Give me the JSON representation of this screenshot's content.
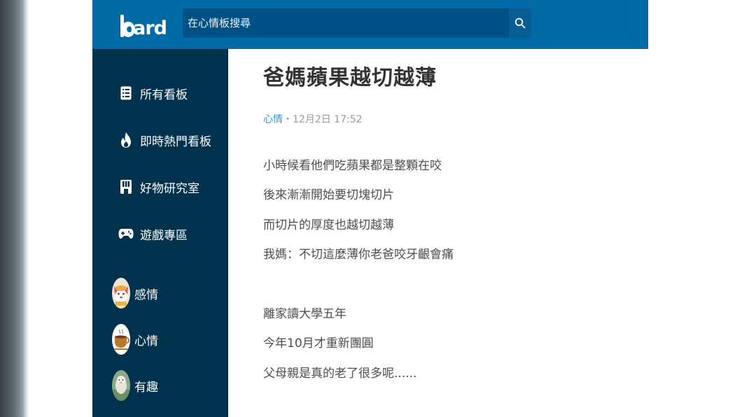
{
  "header": {
    "logo_text": "card",
    "search": {
      "placeholder": "在心情板搜尋"
    }
  },
  "sidebar": {
    "menu": [
      {
        "label": "所有看板",
        "icon": "list-icon"
      },
      {
        "label": "即時熱門看板",
        "icon": "flame-icon"
      },
      {
        "label": "好物研究室",
        "icon": "shop-icon"
      },
      {
        "label": "遊戲專區",
        "icon": "gamepad-icon"
      }
    ],
    "forums": [
      {
        "label": "感情",
        "icon": "dog-avatar"
      },
      {
        "label": "心情",
        "icon": "coffee-avatar"
      },
      {
        "label": "有趣",
        "icon": "alpaca-avatar"
      }
    ]
  },
  "post": {
    "title": "爸媽蘋果越切越薄",
    "forum": "心情",
    "separator": "・",
    "timestamp": "12月2日 17:52",
    "lines": [
      "小時候看他們吃蘋果都是整顆在咬",
      "後來漸漸開始要切塊切片",
      "而切片的厚度也越切越薄",
      "我媽：不切這麼薄你老爸咬牙齦會痛",
      "離家讀大學五年",
      "今年10月才重新團圓",
      "父母親是真的老了很多呢......"
    ]
  },
  "colors": {
    "header_blue": "#006aa6",
    "sidebar_navy": "#00324e",
    "link_blue": "#3397cf"
  }
}
